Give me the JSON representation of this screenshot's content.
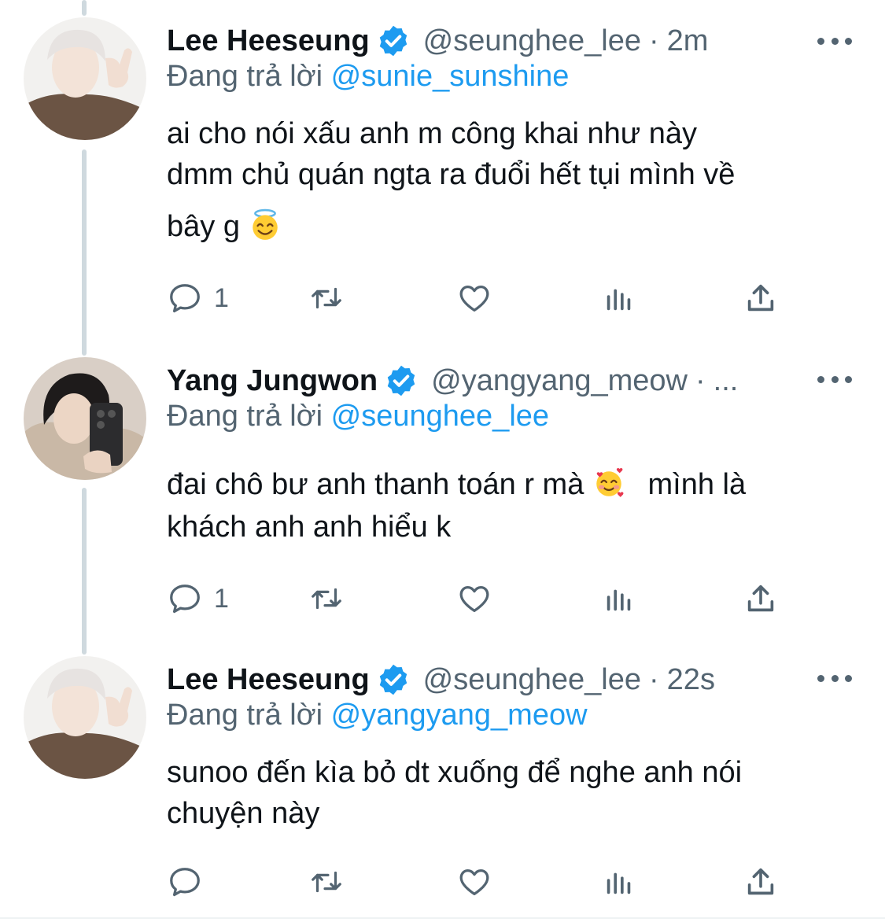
{
  "colors": {
    "link": "#1d9bf0",
    "secondary": "#536471",
    "text": "#0f1419",
    "verified": "#1d9bf0",
    "thread_line": "#cfd9de"
  },
  "icons": {
    "reply": "speech-bubble-icon",
    "retweet": "retweet-icon",
    "like": "heart-icon",
    "views": "bar-chart-icon",
    "share": "share-upload-icon",
    "more": "ellipsis-icon",
    "verified": "verified-badge-icon"
  },
  "tweets": [
    {
      "name": "Lee Heeseung",
      "handle": "@seunghee_lee",
      "separator": "·",
      "time": "2m",
      "replying_prefix": "Đang trả lời",
      "replying_to": "@sunie_sunshine",
      "lines": [
        "ai cho nói xấu anh m công khai như này",
        "dmm chủ quán ngta ra đuổi hết tụi mình về",
        "bây g"
      ],
      "emoji": "smiling-face-with-halo",
      "reply_count": "1"
    },
    {
      "name": "Yang Jungwon",
      "handle": "@yangyang_meow",
      "separator": "·",
      "time": "...",
      "replying_prefix": "Đang trả lời",
      "replying_to": "@seunghee_lee",
      "lines": [
        "đai chô bư anh thanh toán r mà",
        "mình là",
        "khách anh anh hiểu k"
      ],
      "emoji": "smiling-face-with-hearts",
      "reply_count": "1"
    },
    {
      "name": "Lee Heeseung",
      "handle": "@seunghee_lee",
      "separator": "·",
      "time": "22s",
      "replying_prefix": "Đang trả lời",
      "replying_to": "@yangyang_meow",
      "lines": [
        "sunoo đến kìa bỏ dt xuống để nghe anh nói",
        "chuyện này"
      ],
      "reply_count": ""
    }
  ]
}
